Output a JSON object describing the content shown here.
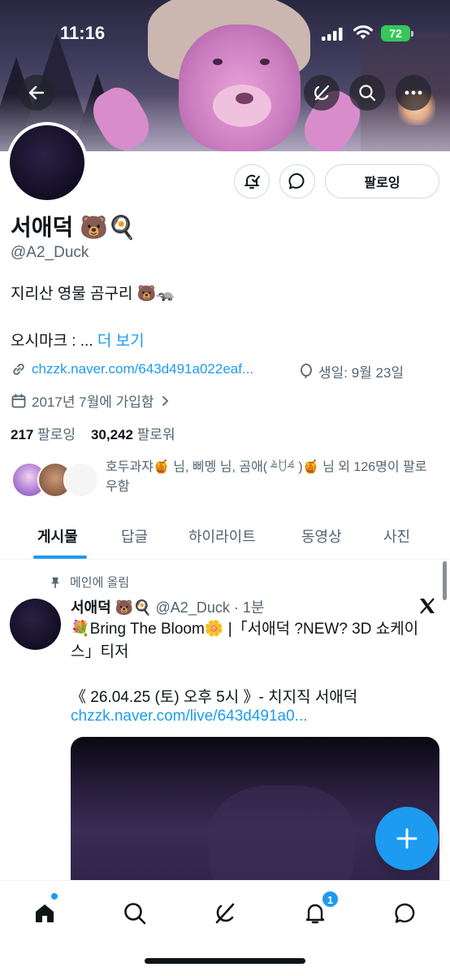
{
  "status_bar": {
    "time": "11:16",
    "battery": "72"
  },
  "profile": {
    "follow_button": "팔로잉",
    "name": "서애덕 🐻🍳",
    "handle": "@A2_Duck",
    "bio_line1": "지리산 영물 곰구리 🐻🦡",
    "bio_line2": "오시마크 : ...",
    "bio_more": "더 보기",
    "link": "chzzk.naver.com/643d491a022eaf...",
    "birthday": "생일: 9월 23일",
    "joined": "2017년 7월에 가입함",
    "following_count": "217",
    "following_label": "팔로잉",
    "followers_count": "30,242",
    "followers_label": "팔로워",
    "mutuals_text": "호두과쟈🍯 님, 삐멩 님, 곰애( ⁼̴̀ꇴ⁼̴́ )🍯 님 외 126명이 팔로우함"
  },
  "tabs": [
    "게시물",
    "답글",
    "하이라이트",
    "동영상",
    "사진"
  ],
  "post": {
    "pinned_label": "메인에 올림",
    "author": "서애덕 🐻🍳",
    "handle_time": "@A2_Duck · 1분",
    "text": "💐Bring The Bloom🌼 |「서애덕 ?NEW? 3D 쇼케이스」티저",
    "date_line": "《 26.04.25 (토) 오후 5시 》- 치지직 서애덕",
    "link": "chzzk.naver.com/live/643d491a0..."
  },
  "bottom_nav": {
    "notifications_badge": "1"
  },
  "colors": {
    "accent": "#1d9bf0",
    "text": "#0f1419",
    "secondary": "#536471"
  },
  "icons": [
    "back-arrow-icon",
    "grok-icon",
    "search-icon",
    "more-icon",
    "notification-settings-icon",
    "message-icon",
    "link-icon",
    "balloon-icon",
    "calendar-icon",
    "pin-icon",
    "x-logo-icon",
    "plus-icon",
    "home-icon",
    "notifications-icon"
  ]
}
